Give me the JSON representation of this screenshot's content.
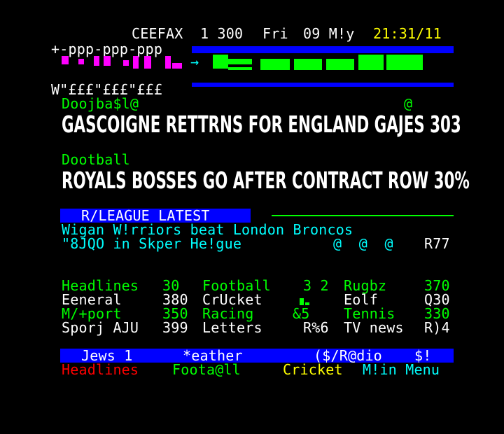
{
  "header": {
    "service": "CEEFAX",
    "page_label": "1 300",
    "day": "Fri",
    "date": "09 M!y",
    "time": "21:31/11"
  },
  "banner": {
    "top_text": "+-ppp-ppp-ppp",
    "bottom_text": "W\"£££\"£££\"£££",
    "arrow_glyph": "→"
  },
  "stories": [
    {
      "category": "Doojba$l@",
      "marker": "@",
      "headline": "GASCOIGNE RETTRNS FOR ENGLAND GAJES 303"
    },
    {
      "category": "Dootball",
      "headline": "ROYALS BOSSES GO AFTER CONTRACT ROW 30%"
    }
  ],
  "league": {
    "heading": "R/LEAGUE LATEST",
    "line1": "Wigan W!rriors beat London Broncos",
    "line2": "\"8JQO in Skper He!gue",
    "markers": "@  @  @",
    "page": "R77"
  },
  "index": [
    [
      {
        "label": "Headlines",
        "page": "30",
        "color": "g"
      },
      {
        "label": "Football",
        "page": "3 2",
        "color": "g"
      },
      {
        "label": "Rugbz",
        "page": "370",
        "color": "g"
      }
    ],
    [
      {
        "label": "Eeneral",
        "page": "380",
        "color": "w"
      },
      {
        "label": "CrUcket",
        "page": "",
        "color": "w"
      },
      {
        "label": "Eolf",
        "page": "Q30",
        "color": "w"
      }
    ],
    [
      {
        "label": "M/+port",
        "page": "350",
        "color": "g"
      },
      {
        "label": "Racing",
        "page": "&5",
        "color": "g"
      },
      {
        "label": "Tennis",
        "page": "330",
        "color": "g"
      }
    ],
    [
      {
        "label": "Sporj AJU",
        "page": "399",
        "color": "w"
      },
      {
        "label": "Letters",
        "page": "R%6",
        "color": "w"
      },
      {
        "label": "TV news",
        "page": "R)4",
        "color": "w"
      }
    ]
  ],
  "promo": {
    "item1": "Jews 1",
    "item2": "*eather",
    "item3": "($/R@dio",
    "item4": "$!"
  },
  "fastext": {
    "red": "Headlines",
    "green": "Foota@ll",
    "yellow": "Cricket",
    "cyan": "M!in Menu"
  },
  "colors": {
    "background": "#000000",
    "teletext_blue": "#0000ff",
    "teletext_green": "#00ff00",
    "teletext_yellow": "#ffff00",
    "teletext_cyan": "#00ffff",
    "teletext_red": "#ff0000",
    "teletext_magenta": "#ff00ff"
  }
}
